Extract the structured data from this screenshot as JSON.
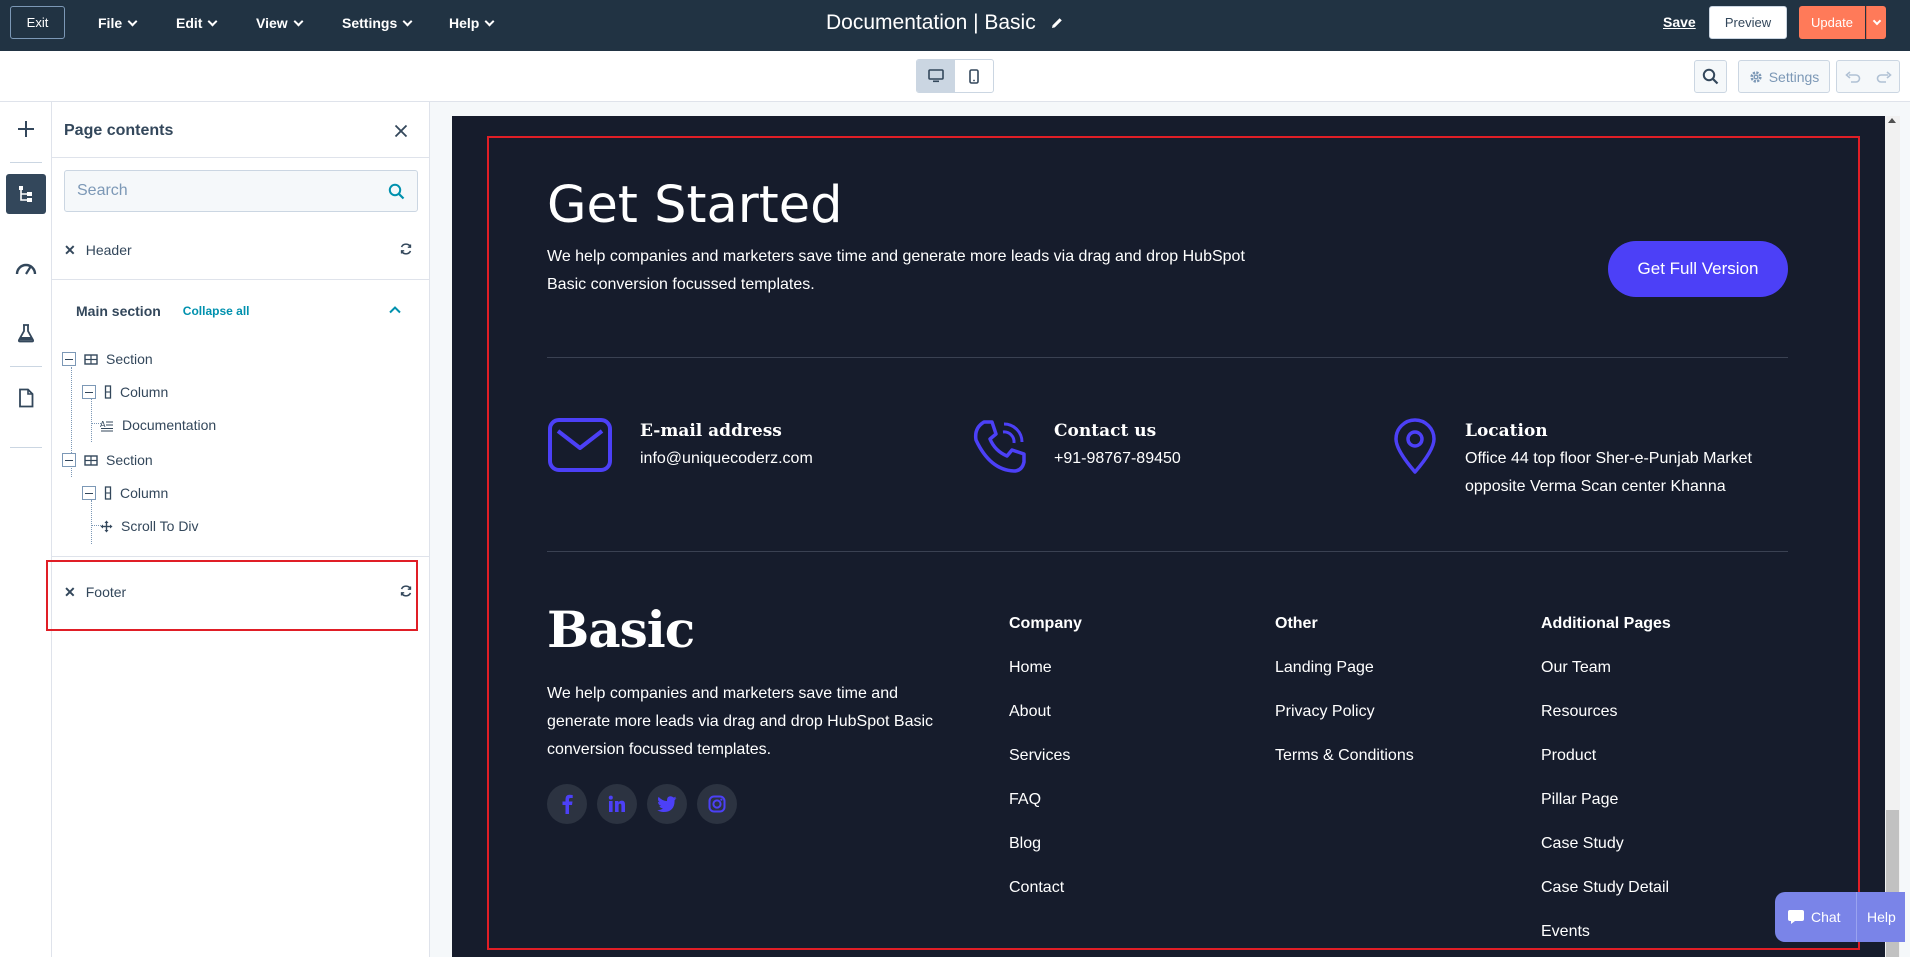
{
  "topbar": {
    "exit_label": "Exit",
    "menus": [
      "File",
      "Edit",
      "View",
      "Settings",
      "Help"
    ],
    "doc_title": "Documentation | Basic",
    "save_label": "Save",
    "preview_label": "Preview",
    "update_label": "Update"
  },
  "toolbar": {
    "settings_label": "Settings"
  },
  "panel": {
    "title": "Page contents",
    "search_placeholder": "Search",
    "header_label": "Header",
    "main_section_label": "Main section",
    "collapse_all_label": "Collapse all",
    "tree": [
      {
        "label": "Section",
        "type": "section"
      },
      {
        "label": "Column",
        "type": "column"
      },
      {
        "label": "Documentation",
        "type": "text"
      },
      {
        "label": "Section",
        "type": "section"
      },
      {
        "label": "Column",
        "type": "column"
      },
      {
        "label": "Scroll To Div",
        "type": "module"
      }
    ],
    "footer_label": "Footer"
  },
  "preview": {
    "cta_title": "Get Started",
    "cta_text": "We help companies and marketers save time and generate more leads via drag and drop HubSpot Basic conversion focussed templates.",
    "cta_button": "Get Full Version",
    "contacts": [
      {
        "label": "E-mail address",
        "value": "info@uniquecoderz.com",
        "icon": "mail-icon"
      },
      {
        "label": "Contact us",
        "value": "+91-98767-89450",
        "icon": "phone-icon"
      },
      {
        "label": "Location",
        "value": "Office 44 top floor Sher-e-Punjab Market opposite Verma Scan center Khanna",
        "icon": "location-pin-icon"
      }
    ],
    "brand": "Basic",
    "brand_text": "We help companies and marketers save time and generate more leads via drag and drop HubSpot Basic conversion focussed templates.",
    "footer_columns": [
      {
        "heading": "Company",
        "links": [
          "Home",
          "About",
          "Services",
          "FAQ",
          "Blog",
          "Contact"
        ]
      },
      {
        "heading": "Other",
        "links": [
          "Landing Page",
          "Privacy Policy",
          "Terms & Conditions"
        ]
      },
      {
        "heading": "Additional Pages",
        "links": [
          "Our Team",
          "Resources",
          "Product",
          "Pillar Page",
          "Case Study",
          "Case Study Detail",
          "Events"
        ]
      }
    ],
    "socials": [
      "facebook-icon",
      "linkedin-icon",
      "twitter-icon",
      "instagram-icon"
    ]
  },
  "chat": {
    "chat_label": "Chat",
    "help_label": "Help"
  },
  "colors": {
    "topbar": "#213343",
    "accent": "#4c40f7",
    "update": "#ff7a59",
    "highlight": "#e01e26",
    "preview_bg": "#161c2c"
  }
}
